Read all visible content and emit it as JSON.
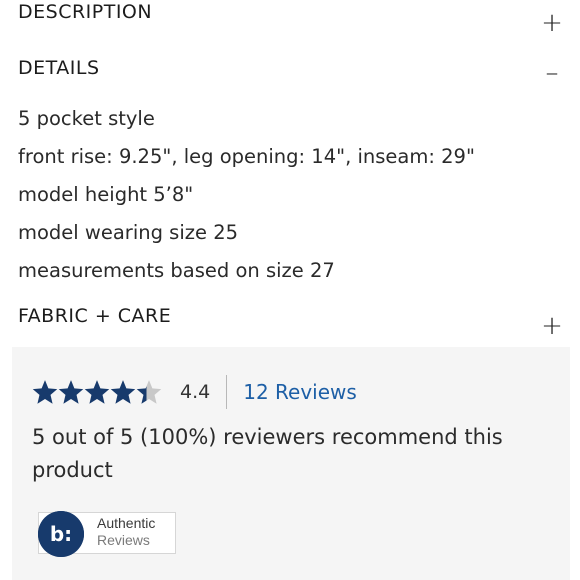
{
  "sections": {
    "description": {
      "title": "DESCRIPTION",
      "toggle": "+"
    },
    "details": {
      "title": "DETAILS",
      "toggle": "–",
      "items": [
        "5 pocket style",
        "front rise: 9.25\", leg opening: 14\", inseam: 29\"",
        "model height 5’8\"",
        "model wearing size 25",
        "measurements based on size 27"
      ]
    },
    "fabric_care": {
      "title": "FABRIC + CARE",
      "toggle": "+"
    }
  },
  "reviews": {
    "rating": 4.4,
    "rating_text": "4.4",
    "stars_total": 5,
    "link_label": "12 Reviews",
    "recommend_text": "5 out of 5 (100%) reviewers recommend this product",
    "badge": {
      "line1": "Authentic",
      "line2": "Reviews",
      "logo_text": "b:"
    },
    "colors": {
      "star_fill": "#173a6c",
      "star_empty": "#c8c8c8",
      "link": "#1d5fa6",
      "badge_logo": "#173a6c"
    }
  }
}
